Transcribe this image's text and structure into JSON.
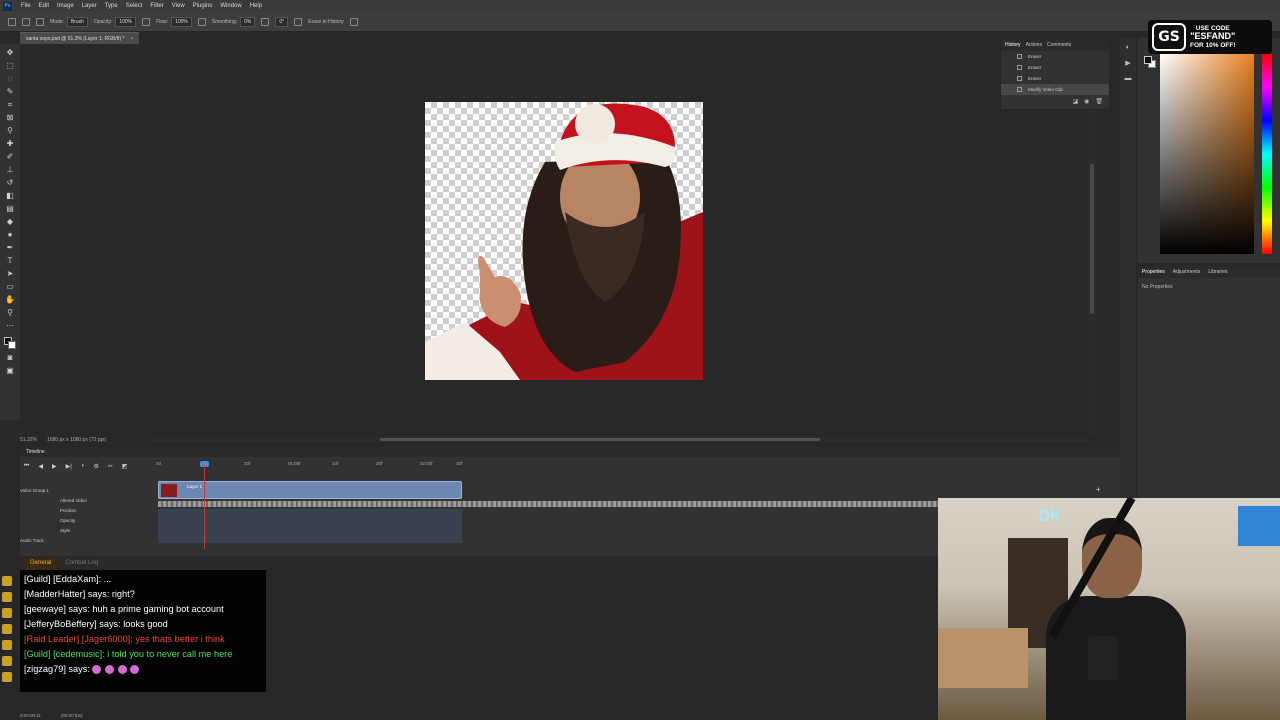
{
  "menubar": {
    "app_logo": "Ps",
    "items": [
      "File",
      "Edit",
      "Image",
      "Layer",
      "Type",
      "Select",
      "Filter",
      "View",
      "Plugins",
      "Window",
      "Help"
    ]
  },
  "options": {
    "mode_label": "Mode:",
    "mode_value": "Brush",
    "opacity_label": "Opacity:",
    "opacity_value": "100%",
    "flow_label": "Flow:",
    "flow_value": "100%",
    "smoothing_label": "Smoothing:",
    "smoothing_value": "0%",
    "angle_value": "0°",
    "erase_history": "Erase to History"
  },
  "document": {
    "tab_title": "santa oops.psd @ 51.3% (Layer 1, RGB/8) *",
    "close_glyph": "×"
  },
  "status": {
    "zoom": "51.32%",
    "dimensions": "1080 px x 1080 px (72 ppi)"
  },
  "history": {
    "tabs": [
      "History",
      "Actions",
      "Comments"
    ],
    "items": [
      "Eraser",
      "Eraser",
      "Eraser",
      "Modify Video Clip"
    ]
  },
  "properties": {
    "tabs": [
      "Properties",
      "Adjustments",
      "Libraries"
    ],
    "empty_text": "No Properties"
  },
  "sponsor": {
    "logo_text": "GS",
    "line1": "USE CODE",
    "line2": "\"ESFAND\"",
    "line3": "FOR 10% OFF!"
  },
  "timeline": {
    "title": "Timeline",
    "ruler": [
      "00",
      "10f",
      "20f",
      "01:00f",
      "10f",
      "20f",
      "02:00f",
      "10f"
    ],
    "group_label": "Video Group 1",
    "layer_label": "Layer 1",
    "props": [
      "Altered Video",
      "Position",
      "Opacity",
      "Style"
    ],
    "audio_label": "Audio Track",
    "add_glyph": "+"
  },
  "chat": {
    "tabs": [
      "General",
      "Combat Log"
    ],
    "lines": [
      {
        "text": "[Guild] [EddaXam]: ...",
        "color": "c-white"
      },
      {
        "text": "[MadderHatter] says:  right?",
        "color": "c-white"
      },
      {
        "text": "[geewaye] says:  huh a prime gaming bot account",
        "color": "c-white"
      },
      {
        "text": "[JefferyBoBeffery] says:  looks good",
        "color": "c-white"
      },
      {
        "text": "[Raid Leader] [Jager6000]: yes thats better i think",
        "color": "c-red"
      },
      {
        "text": "[Guild] [cedemusic]:  i told you to never call me here",
        "color": "c-green"
      },
      {
        "text": "[zigzag79] says: ",
        "color": "c-white"
      }
    ]
  },
  "bottom": {
    "timecode": "0:00:00:11",
    "fps": "(60.00 fps)"
  },
  "webcam": {
    "neon_text": "DK"
  },
  "colors": {
    "accent_blue": "#31a8ff",
    "clip_blue": "#6d87b5",
    "playhead_red": "#c23b3b",
    "chat_red": "#e84a3a",
    "chat_green": "#4ae05a"
  }
}
